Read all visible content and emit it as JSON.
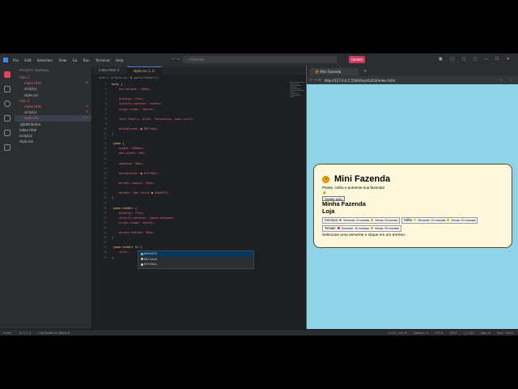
{
  "window": {
    "menu": [
      "File",
      "Edit",
      "Selection",
      "View",
      "Go",
      "Run",
      "Terminal",
      "Help"
    ],
    "search_placeholder": "Fazenda",
    "update_label": "Update"
  },
  "sidebar": {
    "header": "PROJETO FAZENDA",
    "items": [
      {
        "label": "Aula 2",
        "indent": 1,
        "error": true,
        "badge": ""
      },
      {
        "label": "index.html",
        "indent": 2,
        "error": true,
        "badge": "M"
      },
      {
        "label": "script.js",
        "indent": 2,
        "error": false,
        "badge": ""
      },
      {
        "label": "style.css",
        "indent": 2,
        "error": false,
        "badge": ""
      },
      {
        "label": "Aula 3",
        "indent": 1,
        "error": true,
        "badge": ""
      },
      {
        "label": "index.html",
        "indent": 2,
        "error": true,
        "badge": "U"
      },
      {
        "label": "script.js",
        "indent": 2,
        "error": false,
        "badge": "U"
      },
      {
        "label": "style.css",
        "indent": 2,
        "error": true,
        "badge": "1, U",
        "selected": true
      },
      {
        "label": ".gitattributes",
        "indent": 1,
        "error": false,
        "badge": ""
      },
      {
        "label": "index.html",
        "indent": 1,
        "error": false,
        "badge": ""
      },
      {
        "label": "script.js",
        "indent": 1,
        "error": false,
        "badge": ""
      },
      {
        "label": "style.css",
        "indent": 1,
        "error": false,
        "badge": ""
      }
    ]
  },
  "editor": {
    "tabs": [
      {
        "label": "index.html U",
        "active": false
      },
      {
        "label": "style.css 1, U",
        "active": true
      }
    ],
    "breadcrumb": "Aula 3 › # style.css › ✿ .game-header h1",
    "lines": [
      {
        "n": "1",
        "t": "body {",
        "k": "sel"
      },
      {
        "n": "2",
        "t": "    min-height: 100vh;",
        "k": "prop"
      },
      {
        "n": "3",
        "t": "",
        "k": ""
      },
      {
        "n": "4",
        "t": "    display: flex;",
        "k": "prop"
      },
      {
        "n": "5",
        "t": "    justify-content: center;",
        "k": "prop"
      },
      {
        "n": "6",
        "t": "    align-items: center;",
        "k": "prop"
      },
      {
        "n": "7",
        "t": "",
        "k": ""
      },
      {
        "n": "8",
        "t": "    font-family: Arial, Helvetica, sans-serif;",
        "k": "prop"
      },
      {
        "n": "9",
        "t": "",
        "k": ""
      },
      {
        "n": "10",
        "t": "    background: ■ #87ceeb;",
        "k": "prop",
        "swatch": "#87ceeb"
      },
      {
        "n": "11",
        "t": "}",
        "k": "punc"
      },
      {
        "n": "12",
        "t": "",
        "k": ""
      },
      {
        "n": "13",
        "t": ".game {",
        "k": "sel"
      },
      {
        "n": "14",
        "t": "    width: 1000px;",
        "k": "prop"
      },
      {
        "n": "15",
        "t": "    max-width: 90%;",
        "k": "prop"
      },
      {
        "n": "16",
        "t": "",
        "k": ""
      },
      {
        "n": "17",
        "t": "    padding: 30px;",
        "k": "prop"
      },
      {
        "n": "18",
        "t": "",
        "k": ""
      },
      {
        "n": "19",
        "t": "    background: ■ #fff8dc;",
        "k": "prop",
        "swatch": "#fff8dc"
      },
      {
        "n": "20",
        "t": "",
        "k": ""
      },
      {
        "n": "21",
        "t": "    border-radius: 20px;",
        "k": "prop"
      },
      {
        "n": "22",
        "t": "",
        "k": ""
      },
      {
        "n": "23",
        "t": "    border: 3px solid ■ #6b4423;",
        "k": "prop",
        "swatch": "#6b4423"
      },
      {
        "n": "24",
        "t": "}",
        "k": "punc"
      },
      {
        "n": "25",
        "t": "",
        "k": ""
      },
      {
        "n": "26",
        "t": ".game-header {",
        "k": "sel"
      },
      {
        "n": "27",
        "t": "    display: flex;",
        "k": "prop"
      },
      {
        "n": "28",
        "t": "    justify-content: space-between;",
        "k": "prop"
      },
      {
        "n": "29",
        "t": "    align-items: center;",
        "k": "prop"
      },
      {
        "n": "30",
        "t": "",
        "k": ""
      },
      {
        "n": "31",
        "t": "    margin-bottom: 30px;",
        "k": "prop"
      },
      {
        "n": "32",
        "t": "}",
        "k": "punc"
      },
      {
        "n": "33",
        "t": "",
        "k": ""
      },
      {
        "n": "34",
        "t": ".game-header h1 {",
        "k": "sel"
      },
      {
        "n": "35",
        "t": "    color: ",
        "k": "prop"
      },
      {
        "n": "36",
        "t": "}",
        "k": "punc"
      }
    ],
    "suggestions": [
      "#6b4423",
      "#87ceeb",
      "#fff8dc"
    ]
  },
  "browser": {
    "tab_title": "Mini Fazenda",
    "url": "http://127.0.0.1:5500/Aula%203/index.html",
    "game": {
      "title": "Mini Fazenda",
      "subtitle": "Plante, colha e aumente sua fazenda!",
      "sell_label": "Vender tudo",
      "farm_heading": "Minha Fazenda",
      "shop_heading": "Loja",
      "crops": [
        {
          "name": "Cenoura",
          "seed": "Semente: 5 moedas",
          "sell": "Venda: 8 moedas",
          "color": "#e8742a"
        },
        {
          "name": "Milho",
          "seed": "Semente: 10 moedas",
          "sell": "Venda: 15 moedas",
          "color": "#e8c42a"
        },
        {
          "name": "Tomate",
          "seed": "Semente: 15 moedas",
          "sell": "Venda: 25 moedas",
          "color": "#d8322a"
        }
      ],
      "hint": "Selecione uma semente e clique em um terreno."
    }
  },
  "statusbar": {
    "branch": "main*",
    "problems": "⊗ 1  ⚠ 0",
    "live_share": "Connected to Discord",
    "position": "Ln 41, Col 15",
    "spaces": "Spaces: 4",
    "encoding": "UTF-8",
    "eol": "CRLF",
    "lang": "{} CSS",
    "signin": "Sign In",
    "port": "Port : 5500"
  },
  "colors": {
    "accent": "#4e7fd8",
    "update_btn": "#c73e5a",
    "browser_bg": "#87ceeb",
    "game_bg": "#fff8dc",
    "game_border": "#6b4423"
  }
}
